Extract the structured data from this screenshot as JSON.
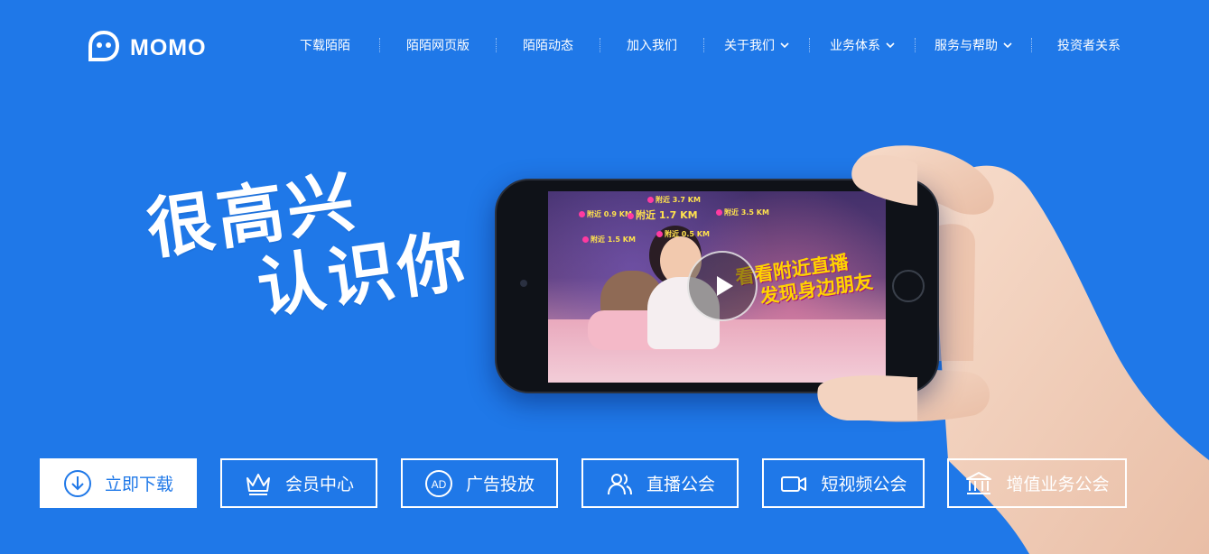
{
  "colors": {
    "background": "#1f78e8",
    "text": "#ffffff",
    "promo": "#ffd400",
    "tag": "#ffe24d"
  },
  "logo": {
    "text": "MOMO",
    "icon": "momo-logo-icon"
  },
  "nav": {
    "items": [
      {
        "label": "下载陌陌",
        "dropdown": false
      },
      {
        "label": "陌陌网页版",
        "dropdown": false
      },
      {
        "label": "陌陌动态",
        "dropdown": false
      },
      {
        "label": "加入我们",
        "dropdown": false
      },
      {
        "label": "关于我们",
        "dropdown": true
      },
      {
        "label": "业务体系",
        "dropdown": true
      },
      {
        "label": "服务与帮助",
        "dropdown": true
      },
      {
        "label": "投资者关系",
        "dropdown": false
      }
    ]
  },
  "hero": {
    "slogan_line1": "很高兴",
    "slogan_line2": "认识你",
    "video": {
      "promo_line1": "看看附近直播",
      "promo_line2": "发现身边朋友",
      "play_icon": "play-icon",
      "tags": [
        "附近 0.9 KM",
        "附近 1.7 KM",
        "附近 3.7 KM",
        "附近 3.5 KM",
        "附近 0.5 KM",
        "附近 1.5 KM"
      ]
    }
  },
  "buttons": [
    {
      "label": "立即下载",
      "icon": "download-icon",
      "primary": true
    },
    {
      "label": "会员中心",
      "icon": "crown-icon",
      "primary": false
    },
    {
      "label": "广告投放",
      "icon": "ad-icon",
      "primary": false
    },
    {
      "label": "直播公会",
      "icon": "users-icon",
      "primary": false
    },
    {
      "label": "短视频公会",
      "icon": "video-camera-icon",
      "primary": false
    },
    {
      "label": "增值业务公会",
      "icon": "bank-icon",
      "primary": false
    }
  ]
}
